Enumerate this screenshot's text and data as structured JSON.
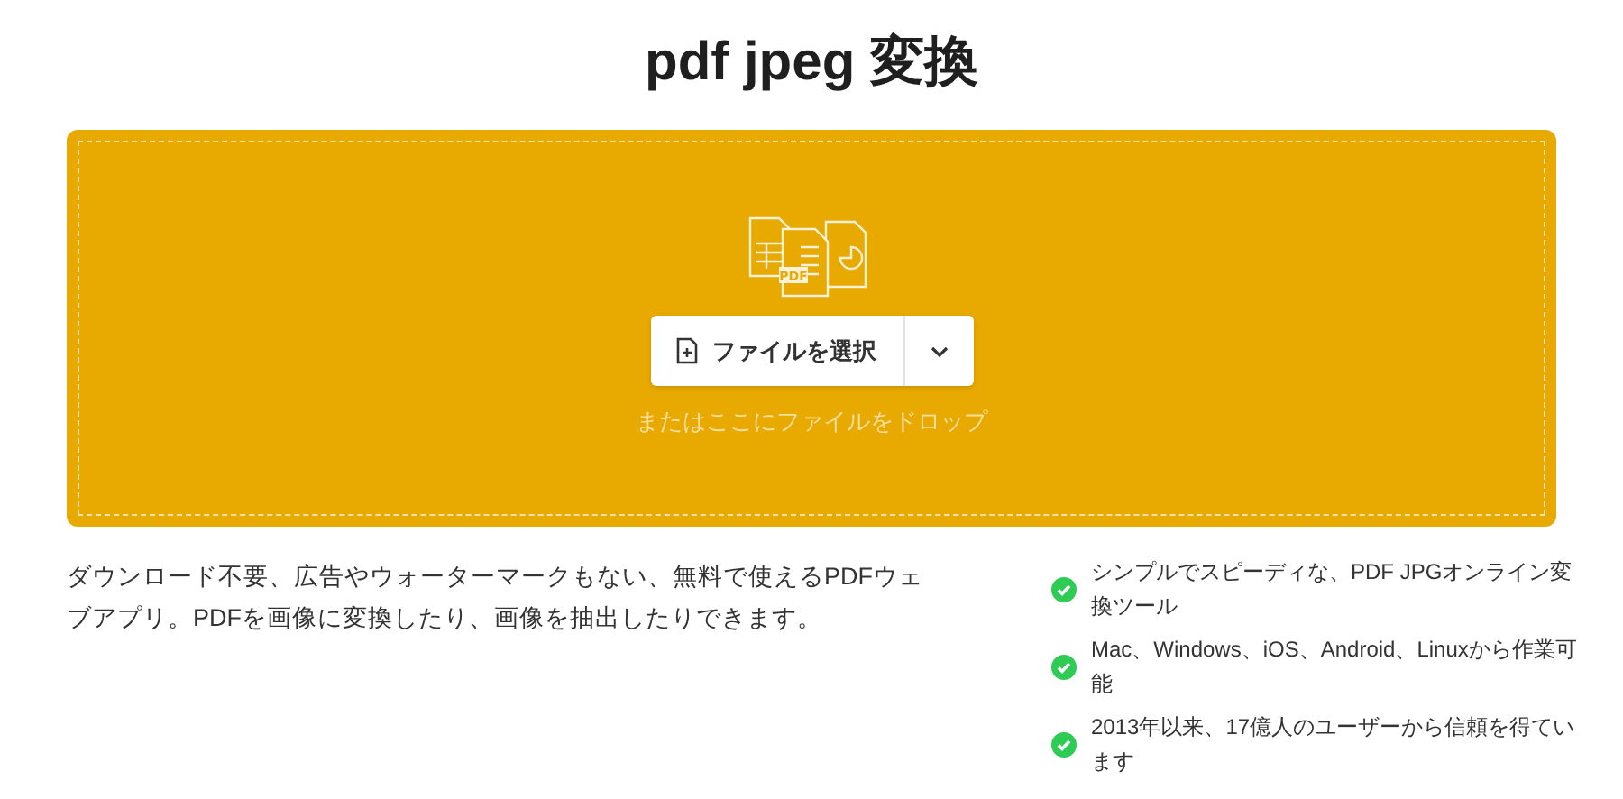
{
  "title": "pdf jpeg 変換",
  "dropzone": {
    "icon_label": "PDF",
    "button": "ファイルを選択",
    "hint": "またはここにファイルをドロップ"
  },
  "description": "ダウンロード不要、広告やウォーターマークもない、無料で使えるPDFウェブアプリ。PDFを画像に変換したり、画像を抽出したりできます。",
  "features": [
    {
      "text": "シンプルでスピーディな、PDF JPGオンライン変換ツール"
    },
    {
      "text": "Mac、Windows、iOS、Android、Linuxから作業可能"
    },
    {
      "text": "2013年以来、17億人のユーザーから信頼を得ています"
    }
  ]
}
